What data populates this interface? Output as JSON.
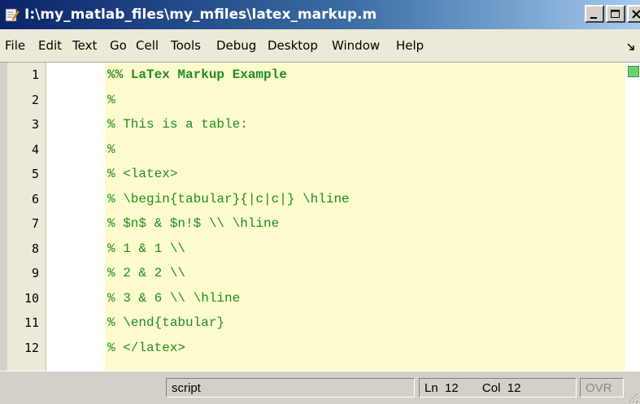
{
  "window": {
    "title": "I:\\my_matlab_files\\my_mfiles\\latex_markup.m"
  },
  "menu": [
    {
      "label": "File"
    },
    {
      "label": "Edit"
    },
    {
      "label": "Text"
    },
    {
      "label": "Go"
    },
    {
      "label": "Cell"
    },
    {
      "label": "Tools"
    },
    {
      "label": "Debug"
    },
    {
      "label": "Desktop"
    },
    {
      "label": "Window"
    },
    {
      "label": "Help"
    }
  ],
  "editor": {
    "lines": [
      {
        "num": "1",
        "text": "%% LaTex Markup Example"
      },
      {
        "num": "2",
        "text": "%"
      },
      {
        "num": "3",
        "text": "% This is a table:"
      },
      {
        "num": "4",
        "text": "%"
      },
      {
        "num": "5",
        "text": "% <latex>"
      },
      {
        "num": "6",
        "text": "% \\begin{tabular}{|c|c|} \\hline"
      },
      {
        "num": "7",
        "text": "% $n$ & $n!$ \\\\ \\hline"
      },
      {
        "num": "8",
        "text": "% 1 & 1 \\\\"
      },
      {
        "num": "9",
        "text": "% 2 & 2 \\\\"
      },
      {
        "num": "10",
        "text": "% 3 & 6 \\\\ \\hline"
      },
      {
        "num": "11",
        "text": "% \\end{tabular}"
      },
      {
        "num": "12",
        "text": "% </latex>"
      }
    ],
    "comment_color": "#228b22",
    "cell_highlight_color": "#fcfccf"
  },
  "status": {
    "mode": "script",
    "ln_label": "Ln",
    "ln_value": "12",
    "col_label": "Col",
    "col_value": "12",
    "ovr": "OVR"
  },
  "icons": {
    "app": "matlab-editor-icon",
    "minimize": "minimize-icon",
    "maximize": "maximize-icon",
    "close": "close-icon",
    "dock": "dock-arrow-icon",
    "grip": "resize-grip-icon"
  }
}
